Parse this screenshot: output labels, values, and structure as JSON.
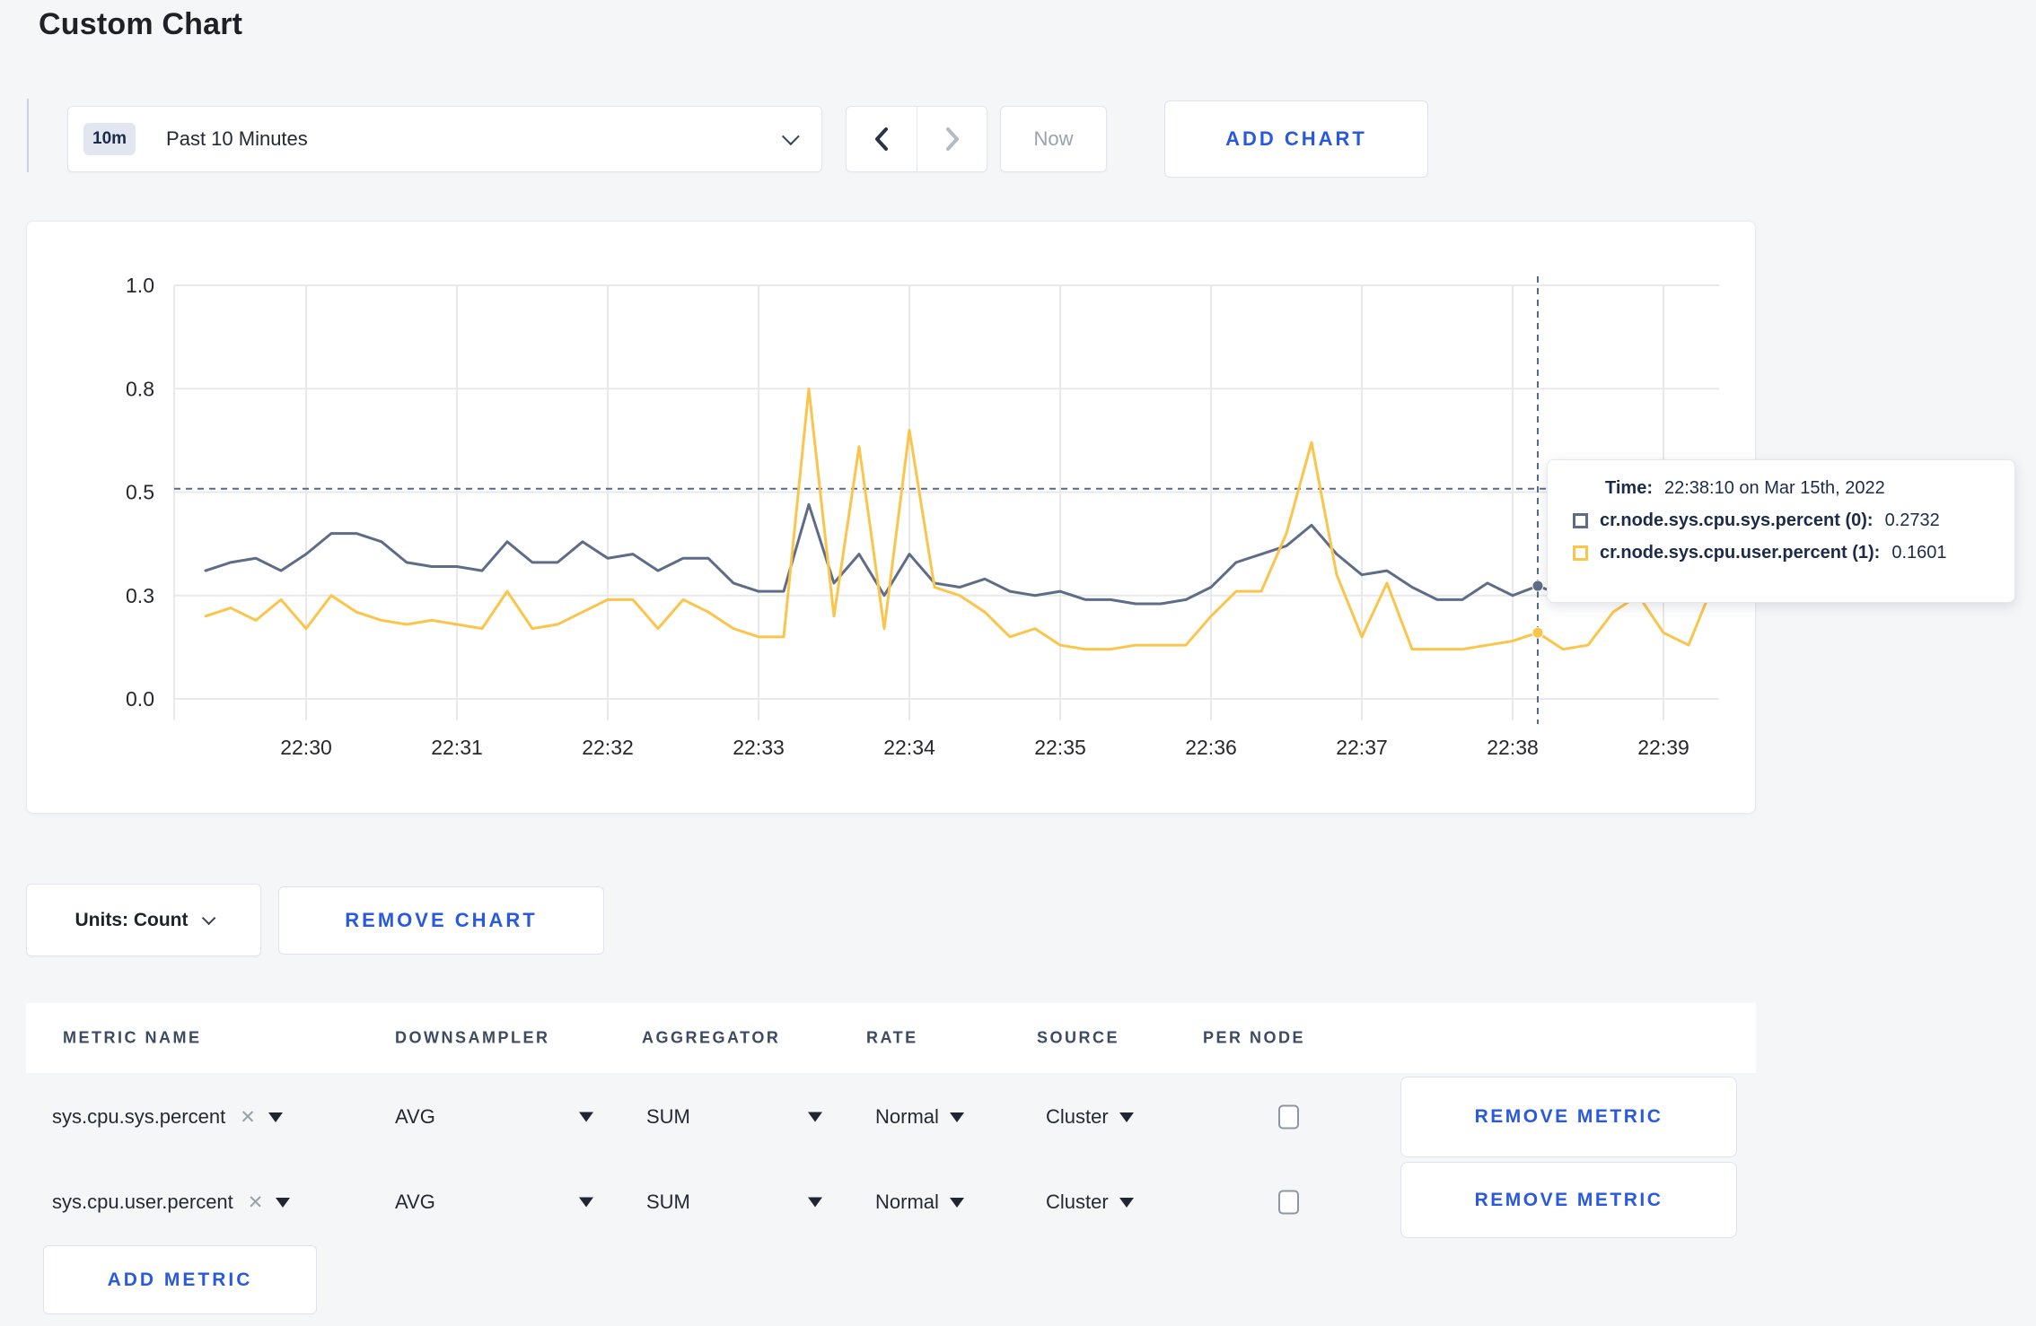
{
  "page_title": "Custom Chart",
  "toolbar": {
    "time_badge": "10m",
    "time_range_label": "Past 10 Minutes",
    "now_label": "Now",
    "add_chart_label": "ADD CHART"
  },
  "chart_data": {
    "type": "line",
    "x": [
      "22:29:20",
      "22:29:30",
      "22:29:40",
      "22:29:50",
      "22:30:00",
      "22:30:10",
      "22:30:20",
      "22:30:30",
      "22:30:40",
      "22:30:50",
      "22:31:00",
      "22:31:10",
      "22:31:20",
      "22:31:30",
      "22:31:40",
      "22:31:50",
      "22:32:00",
      "22:32:10",
      "22:32:20",
      "22:32:30",
      "22:32:40",
      "22:32:50",
      "22:33:00",
      "22:33:10",
      "22:33:20",
      "22:33:30",
      "22:33:40",
      "22:33:50",
      "22:34:00",
      "22:34:10",
      "22:34:20",
      "22:34:30",
      "22:34:40",
      "22:34:50",
      "22:35:00",
      "22:35:10",
      "22:35:20",
      "22:35:30",
      "22:35:40",
      "22:35:50",
      "22:36:00",
      "22:36:10",
      "22:36:20",
      "22:36:30",
      "22:36:40",
      "22:36:50",
      "22:37:00",
      "22:37:10",
      "22:37:20",
      "22:37:30",
      "22:37:40",
      "22:37:50",
      "22:38:00",
      "22:38:10",
      "22:38:20",
      "22:38:30",
      "22:38:40",
      "22:38:50",
      "22:39:00",
      "22:39:10",
      "22:39:20"
    ],
    "series": [
      {
        "name": "cr.node.sys.cpu.sys.percent (0)",
        "color": "#5f6c87",
        "values": [
          0.31,
          0.33,
          0.34,
          0.31,
          0.35,
          0.4,
          0.4,
          0.38,
          0.33,
          0.32,
          0.32,
          0.31,
          0.38,
          0.33,
          0.33,
          0.38,
          0.34,
          0.35,
          0.31,
          0.34,
          0.34,
          0.28,
          0.26,
          0.26,
          0.47,
          0.28,
          0.35,
          0.25,
          0.35,
          0.28,
          0.27,
          0.29,
          0.26,
          0.25,
          0.26,
          0.24,
          0.24,
          0.23,
          0.23,
          0.24,
          0.27,
          0.33,
          0.35,
          0.37,
          0.42,
          0.35,
          0.3,
          0.31,
          0.27,
          0.24,
          0.24,
          0.28,
          0.25,
          0.2732,
          0.25,
          0.26,
          0.29,
          0.31,
          0.3,
          0.3,
          0.31
        ]
      },
      {
        "name": "cr.node.sys.cpu.user.percent (1)",
        "color": "#fbc54c",
        "values": [
          0.2,
          0.22,
          0.19,
          0.24,
          0.17,
          0.25,
          0.21,
          0.19,
          0.18,
          0.19,
          0.18,
          0.17,
          0.26,
          0.17,
          0.18,
          0.21,
          0.24,
          0.24,
          0.17,
          0.24,
          0.21,
          0.17,
          0.15,
          0.15,
          0.75,
          0.2,
          0.61,
          0.17,
          0.65,
          0.27,
          0.25,
          0.21,
          0.15,
          0.17,
          0.13,
          0.12,
          0.12,
          0.13,
          0.13,
          0.13,
          0.2,
          0.26,
          0.26,
          0.4,
          0.62,
          0.3,
          0.15,
          0.28,
          0.12,
          0.12,
          0.12,
          0.13,
          0.14,
          0.1601,
          0.12,
          0.13,
          0.21,
          0.25,
          0.16,
          0.13,
          0.28
        ]
      }
    ],
    "ylim": [
      0,
      1
    ],
    "yticks": {
      "values": [
        0,
        0.25,
        0.5,
        0.75,
        1.0
      ],
      "labels": [
        "0.0",
        "0.3",
        "0.5",
        "0.8",
        "1.0"
      ]
    },
    "xticks": {
      "labels": [
        "22:30",
        "22:31",
        "22:32",
        "22:33",
        "22:34",
        "22:35",
        "22:36",
        "22:37",
        "22:38",
        "22:39"
      ],
      "indices": [
        4,
        10,
        16,
        22,
        28,
        34,
        40,
        46,
        52,
        58
      ]
    },
    "grid": true,
    "crosshair": {
      "index": 53,
      "hline_value": 0.508,
      "color": "#566a8f"
    },
    "legend_position": "tooltip"
  },
  "tooltip": {
    "time_label": "Time:",
    "time_value": "22:38:10 on Mar 15th, 2022",
    "rows": [
      {
        "label": "cr.node.sys.cpu.sys.percent (0):",
        "value": "0.2732"
      },
      {
        "label": "cr.node.sys.cpu.user.percent (1):",
        "value": "0.1601"
      }
    ]
  },
  "units_label": "Units: Count",
  "remove_chart_label": "REMOVE CHART",
  "metrics_table": {
    "headers": [
      "METRIC NAME",
      "DOWNSAMPLER",
      "AGGREGATOR",
      "RATE",
      "SOURCE",
      "PER NODE"
    ],
    "rows": [
      {
        "metric": "sys.cpu.sys.percent",
        "clear": "✕",
        "downsampler": "AVG",
        "aggregator": "SUM",
        "rate": "Normal",
        "source": "Cluster",
        "per_node_checked": false,
        "remove_label": "REMOVE METRIC"
      },
      {
        "metric": "sys.cpu.user.percent",
        "clear": "✕",
        "downsampler": "AVG",
        "aggregator": "SUM",
        "rate": "Normal",
        "source": "Cluster",
        "per_node_checked": false,
        "remove_label": "REMOVE METRIC"
      }
    ],
    "add_metric_label": "ADD METRIC"
  }
}
